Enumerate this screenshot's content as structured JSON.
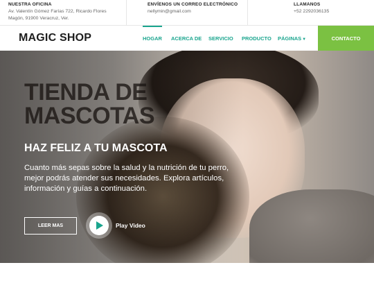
{
  "topbar": {
    "office": {
      "title": "NUESTRA  OFICINA",
      "line1": "Av. Valentín Gómez Farías 722, Ricardo Flores",
      "line2": "Magón, 91900 Veracruz, Ver."
    },
    "email": {
      "title": "ENVÍENOS UN CORREO ELECTRÓNICO",
      "value": "nellymin@gmail.com"
    },
    "phone": {
      "title": "LLAMANOS",
      "value": "+52 2292036135"
    }
  },
  "nav": {
    "brand": "MAGIC SHOP",
    "items": [
      {
        "label": "HOGAR",
        "active": true
      },
      {
        "label": "ACERCA DE"
      },
      {
        "label": "SERVICIO"
      },
      {
        "label": "PRODUCTO"
      },
      {
        "label": "PÁGINAS"
      }
    ],
    "contact": "CONTACTO",
    "accent": "#1aa58e",
    "cta_color": "#7bc142"
  },
  "hero": {
    "big_line1": "TIENDA DE",
    "big_line2": "MASCOTAS",
    "subtitle": "HAZ FELIZ A TU MASCOTA",
    "description": "Cuanto más sepas sobre la salud y la nutrición de tu perro, mejor podrás atender sus necesidades. Explora artículos, información y guías a continuación.",
    "read_more": "LEER MAS",
    "play_label": "Play Video"
  },
  "icons": {
    "dropdown": "chevron-down-icon",
    "play": "play-icon"
  }
}
